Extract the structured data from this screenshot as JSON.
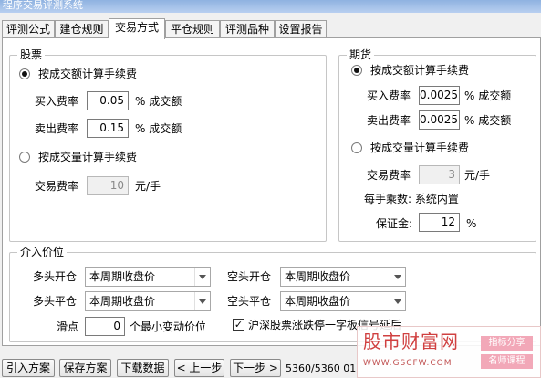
{
  "window": {
    "title": "程序交易评测系统"
  },
  "tabs": [
    "评测公式",
    "建仓规则",
    "交易方式",
    "平仓规则",
    "评测品种",
    "设置报告"
  ],
  "stock": {
    "title": "股票",
    "by_amount": "按成交额计算手续费",
    "buy_rate_label": "买入费率",
    "buy_rate": "0.05",
    "sell_rate_label": "卖出费率",
    "sell_rate": "0.15",
    "pct_unit": "% 成交额",
    "by_volume": "按成交量计算手续费",
    "fee_rate_label": "交易费率",
    "fee_rate": "10",
    "fee_unit": "元/手"
  },
  "futures": {
    "title": "期货",
    "by_amount": "按成交额计算手续费",
    "buy_rate_label": "买入费率",
    "buy_rate": "0.0025",
    "sell_rate_label": "卖出费率",
    "sell_rate": "0.0025",
    "pct_unit": "% 成交额",
    "by_volume": "按成交量计算手续费",
    "fee_rate_label": "交易费率",
    "fee_rate": "3",
    "fee_unit": "元/手",
    "lot_text": "每手乘数: 系统内置",
    "margin_label": "保证金:",
    "margin": "12",
    "margin_unit": "%"
  },
  "entry": {
    "title": "介入价位",
    "long_open_label": "多头开仓",
    "long_open": "本周期收盘价",
    "short_open_label": "空头开仓",
    "short_open": "本周期收盘价",
    "long_close_label": "多头平仓",
    "long_close": "本周期收盘价",
    "short_close_label": "空头平仓",
    "short_close": "本周期收盘价",
    "slippage_label": "滑点",
    "slippage": "0",
    "slippage_unit": "个最小变动价位",
    "limit_check": "✓",
    "limit_text": "沪深股票涨跌停一字板信号延后"
  },
  "buttons": {
    "import": "引入方案",
    "save": "保存方案",
    "download": "下载数据",
    "prev": "< 上一步",
    "next": "下一步 >"
  },
  "progress_text": "5360/5360 01",
  "watermark": {
    "main": "股市财富网",
    "url": "WWW.GSCFW.COM",
    "badge1": "指标分享",
    "badge2": "名师课程"
  }
}
